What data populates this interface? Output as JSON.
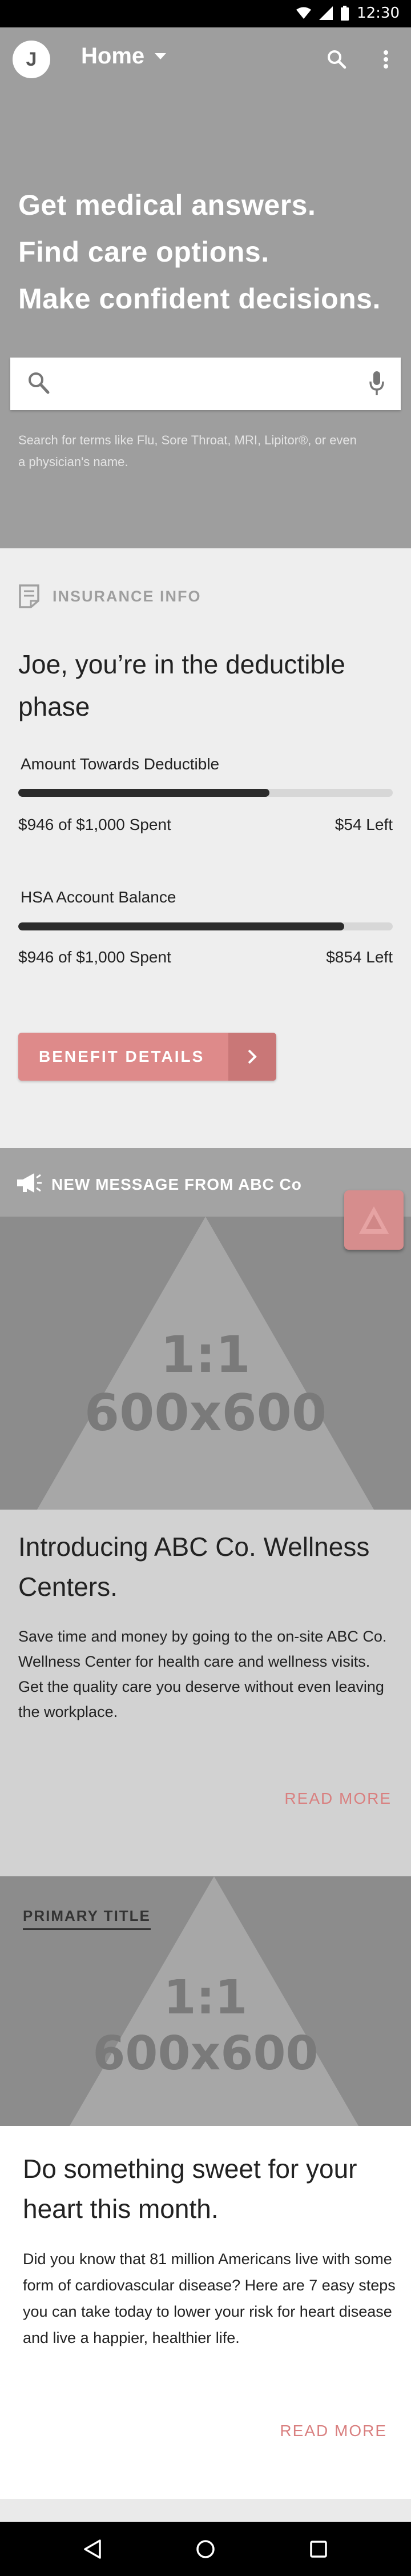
{
  "status_bar": {
    "time": "12:30"
  },
  "app_bar": {
    "avatar_initial": "J",
    "title": "Home",
    "icons": [
      "search-icon",
      "more-vertical-icon",
      "dropdown-caret-icon"
    ]
  },
  "hero": {
    "lines": [
      "Get medical answers.",
      "Find care options.",
      "Make confident decisions."
    ],
    "search": {
      "placeholder": "",
      "value": ""
    },
    "hint": "Search for terms like Flu, Sore Throat, MRI, Lipitor®, or even a physician's name."
  },
  "insurance": {
    "header": "INSURANCE INFO",
    "title": "Joe, you’re in the deductible phase",
    "metrics": [
      {
        "label": "Amount Towards Deductible",
        "spent": "$946 of $1,000 Spent",
        "left": "$54 Left",
        "progress": 0.67
      },
      {
        "label": "HSA Account Balance",
        "spent": "$946 of $1,000 Spent",
        "left": "$854 Left",
        "progress": 0.87
      }
    ],
    "button_label": "BENEFIT DETAILS"
  },
  "message_card": {
    "banner": "NEW MESSAGE FROM ABC Co",
    "placeholder_ratio": "1:1",
    "placeholder_size": "600x600",
    "title": "Introducing ABC Co. Wellness Centers.",
    "body": "Save time and money by going to the on-site ABC Co. Wellness Center for health care and wellness visits. Get the quality care you deserve without even leaving the workplace.",
    "read_more": "READ MORE"
  },
  "card2": {
    "primary_title": "PRIMARY TITLE",
    "placeholder_ratio": "1:1",
    "placeholder_size": "600x600",
    "title": "Do something sweet for your heart this month.",
    "body": "Did you know that 81 million Americans live with some form of cardiovascular disease? Here are 7 easy steps you can take today to lower your risk for heart disease and live a happier, healthier life.",
    "read_more": "READ MORE"
  },
  "colors": {
    "accent": "#de8a8a",
    "app_bar": "#9e9e9e",
    "progress_fill": "#2b2b2b"
  }
}
